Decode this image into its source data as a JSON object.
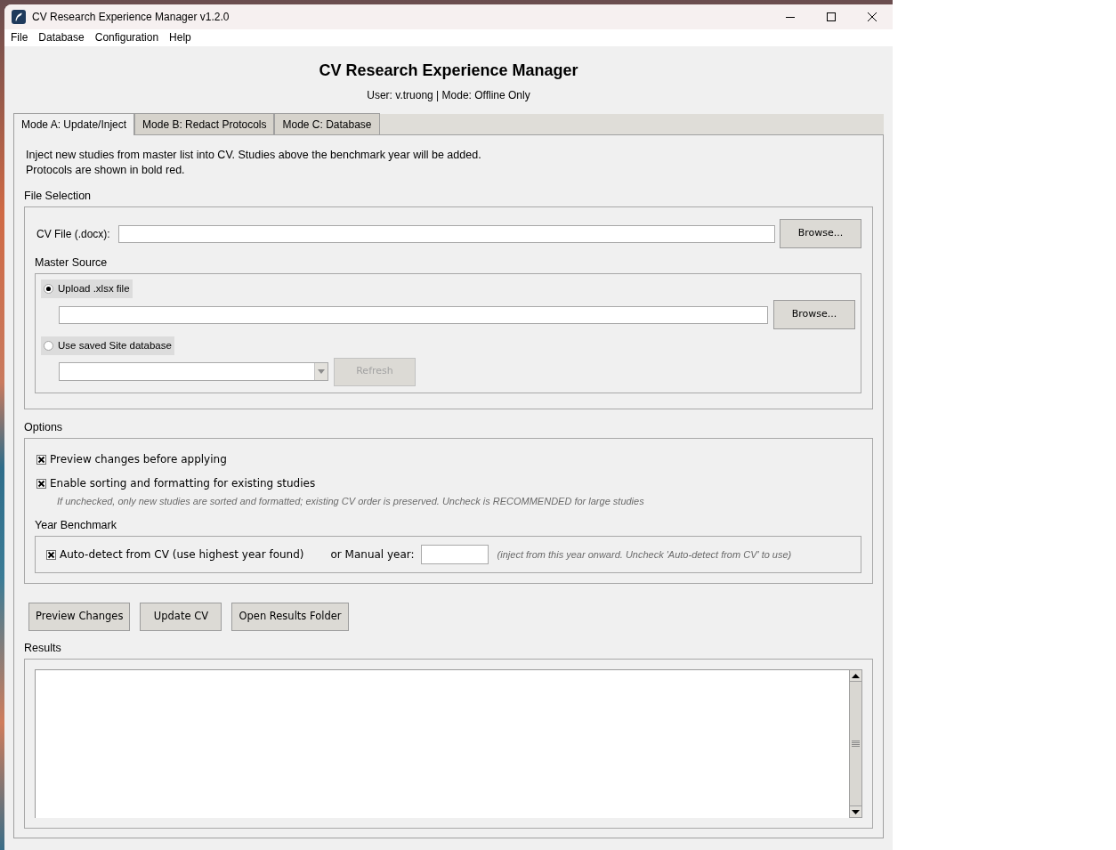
{
  "window": {
    "title": "CV Research Experience Manager v1.2.0"
  },
  "menu": [
    "File",
    "Database",
    "Configuration",
    "Help"
  ],
  "header": {
    "title": "CV Research Experience Manager",
    "subtitle": "User: v.truong | Mode: Offline Only"
  },
  "tabs": [
    {
      "label": "Mode A: Update/Inject",
      "selected": true
    },
    {
      "label": "Mode B: Redact Protocols",
      "selected": false
    },
    {
      "label": "Mode C: Database",
      "selected": false
    }
  ],
  "mode_a": {
    "description": [
      "Inject new studies from master list into CV. Studies above the benchmark year will be added.",
      "Protocols are shown in bold red."
    ],
    "file_selection": {
      "title": "File Selection",
      "cv_file": {
        "label": "CV File (.docx):",
        "button": {
          "label": "Browse...",
          "disabled": false
        }
      },
      "master_source": {
        "title": "Master Source",
        "sources": [
          {
            "kind": "file",
            "label": "Upload .xlsx file",
            "selected": true,
            "button": {
              "label": "Browse...",
              "disabled": false
            }
          },
          {
            "kind": "database",
            "label": "Use saved Site database",
            "selected": false,
            "button": {
              "label": "Refresh",
              "disabled": true
            }
          }
        ]
      }
    },
    "options": {
      "title": "Options",
      "checkboxes": [
        {
          "label": "Preview changes before applying",
          "checked": true
        },
        {
          "label": "Enable sorting and formatting for existing studies",
          "checked": true,
          "hint": "If unchecked, only new studies are sorted and formatted; existing CV order is preserved. Uncheck is RECOMMENDED for large studies"
        }
      ],
      "year_benchmark": {
        "title": "Year Benchmark",
        "auto_detect": {
          "label": "Auto-detect from CV (use highest year found)",
          "checked": true
        },
        "manual_year": {
          "label": "or Manual year:"
        },
        "hint": "(inject from this year onward. Uncheck 'Auto-detect from CV' to use)"
      }
    },
    "actions": [
      {
        "label": "Preview Changes"
      },
      {
        "label": "Update CV"
      },
      {
        "label": "Open Results Folder"
      }
    ],
    "results": {
      "title": "Results"
    }
  }
}
